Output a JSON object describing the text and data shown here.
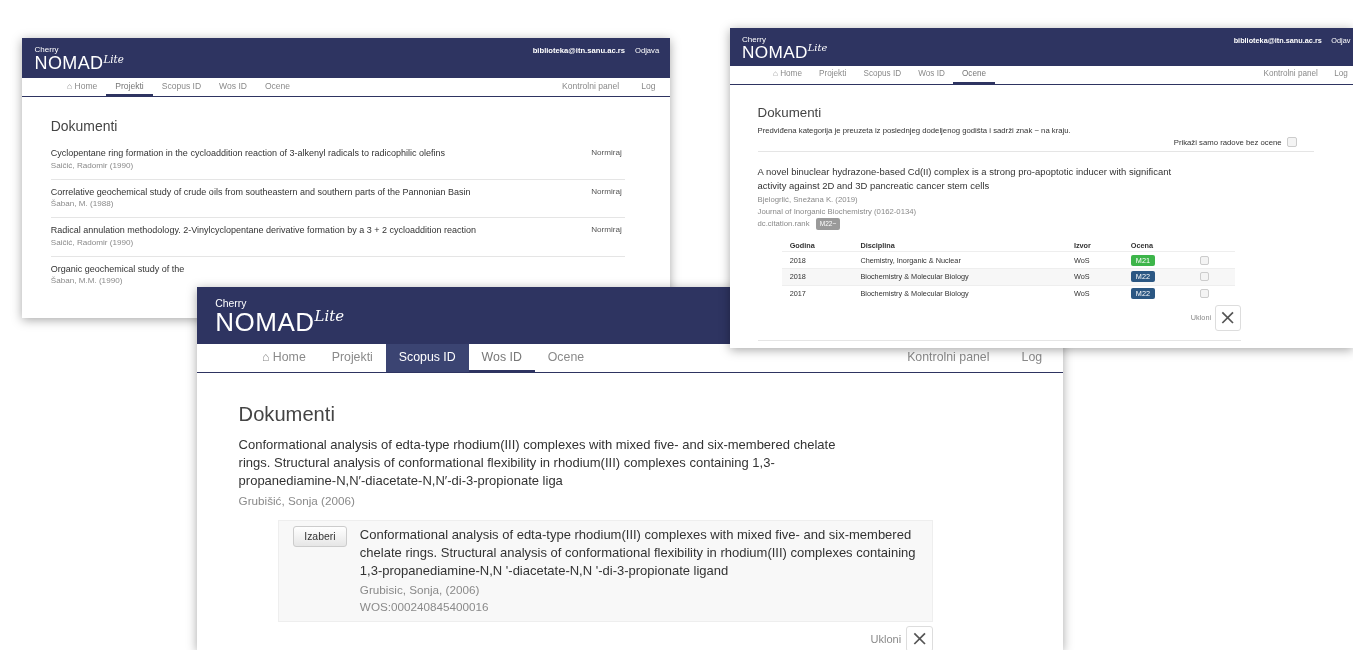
{
  "windows": [
    {
      "kind": "list",
      "logo": {
        "small": "Cherry",
        "word": "NOMAD",
        "sup": "Lite"
      },
      "user": "biblioteka@itn.sanu.ac.rs",
      "logout": "Odjava",
      "tabs": [
        {
          "label": "⌂ Home",
          "selected": false,
          "highlighted": false
        },
        {
          "label": "Projekti",
          "selected": true,
          "highlighted": false
        },
        {
          "label": "Scopus ID",
          "selected": false,
          "highlighted": false
        },
        {
          "label": "Wos ID",
          "selected": false,
          "highlighted": false
        },
        {
          "label": "Ocene",
          "selected": false,
          "highlighted": false
        }
      ],
      "nav_right": [
        "Kontrolni panel",
        "Log"
      ],
      "heading": "Dokumenti",
      "documents": [
        {
          "title": "Cyclopentane ring formation in the cycloaddition reaction of 3-alkenyl radicals to radicophilic olefins",
          "author": "Saičić, Radomir (1990)",
          "action": "Normiraj"
        },
        {
          "title": "Correlative geochemical study of crude oils from southeastern and southern parts of the Pannonian Basin",
          "author": "Šaban, M. (1988)",
          "action": "Normiraj"
        },
        {
          "title": "Radical annulation methodology. 2-Vinylcyclopentane derivative formation by a 3 + 2 cycloaddition reaction",
          "author": "Saičić, Radomir (1990)",
          "action": "Normiraj"
        },
        {
          "title": "Organic geochemical study of the",
          "author": "Šaban, M.M. (1990)"
        }
      ]
    },
    {
      "kind": "match",
      "logo": {
        "small": "Cherry",
        "word": "NOMAD",
        "sup": "Lite"
      },
      "tabs": [
        {
          "label": "⌂ Home",
          "selected": false,
          "highlighted": false
        },
        {
          "label": "Projekti",
          "selected": false,
          "highlighted": false
        },
        {
          "label": "Scopus ID",
          "selected": false,
          "highlighted": true
        },
        {
          "label": "Wos ID",
          "selected": true,
          "highlighted": false
        },
        {
          "label": "Ocene",
          "selected": false,
          "highlighted": false
        }
      ],
      "nav_right": [
        "Kontrolni panel",
        "Log"
      ],
      "heading": "Dokumenti",
      "document": {
        "title": "Conformational analysis of edta-type rhodium(III) complexes with mixed five- and six-membered chelate rings. Structural analysis of conformational flexibility in rhodium(III) complexes containing 1,3-propanediamine-N,N′-diacetate-N,N′-di-3-propionate liga",
        "author": "Grubišić, Sonja (2006)"
      },
      "candidate": {
        "button": "Izaberi",
        "title": "Conformational analysis of edta-type rhodium(III) complexes with mixed five- and six-membered chelate rings. Structural analysis of conformational flexibility in rhodium(III) complexes containing 1,3-propanediamine-N,N '-diacetate-N,N '-di-3-propionate ligand",
        "author": "Grubisic, Sonja, (2006)",
        "id": "WOS:000240845400016"
      },
      "remove": "Ukloni"
    },
    {
      "kind": "ratings",
      "logo": {
        "small": "Cherry",
        "word": "NOMAD",
        "sup": "Lite"
      },
      "user": "biblioteka@itn.sanu.ac.rs",
      "logout": "Odjav",
      "tabs": [
        {
          "label": "⌂ Home",
          "selected": false,
          "highlighted": false
        },
        {
          "label": "Projekti",
          "selected": false,
          "highlighted": false
        },
        {
          "label": "Scopus ID",
          "selected": false,
          "highlighted": false
        },
        {
          "label": "Wos ID",
          "selected": false,
          "highlighted": false
        },
        {
          "label": "Ocene",
          "selected": true,
          "highlighted": false
        }
      ],
      "nav_right": [
        "Kontrolni panel",
        "Log"
      ],
      "heading": "Dokumenti",
      "note": "Predviđena kategorija je preuzeta iz poslednjeg dodeljenog godišta i sadrži znak ~ na kraju.",
      "filter": {
        "label": "Prikaži samo radove bez ocene",
        "checked": false
      },
      "document": {
        "title": "A novel binuclear hydrazone-based Cd(II) complex is a strong pro-apoptotic inducer with significant activity against 2D and 3D pancreatic cancer stem cells",
        "author": "Bjelogrlić, Snežana K. (2019)",
        "journal": "Journal of Inorganic Biochemistry (0162-0134)",
        "rank_label": "dc.citation.rank",
        "rank": "M22~"
      },
      "table": {
        "columns": [
          "Godina",
          "Disciplina",
          "Izvor",
          "Ocena"
        ],
        "rows": [
          {
            "cells": [
              "2018",
              "Chemistry, Inorganic & Nuclear",
              "WoS"
            ],
            "rating": "M21",
            "color": "#3db54a",
            "checked": false
          },
          {
            "cells": [
              "2018",
              "Biochemistry & Molecular Biology",
              "WoS"
            ],
            "rating": "M22",
            "color": "#2b5783",
            "checked": false
          },
          {
            "cells": [
              "2017",
              "Biochemistry & Molecular Biology",
              "WoS"
            ],
            "rating": "M22",
            "color": "#2b5783",
            "checked": false
          }
        ]
      },
      "remove": "Ukloni"
    }
  ]
}
